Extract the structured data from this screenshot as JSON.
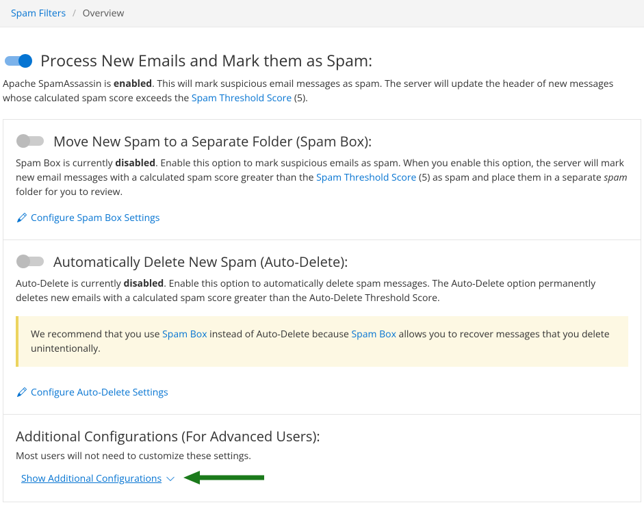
{
  "breadcrumb": {
    "root_label": "Spam Filters",
    "current_label": "Overview"
  },
  "section1": {
    "title": "Process New Emails and Mark them as Spam:",
    "desc_pre": "Apache SpamAssassin is ",
    "status": "enabled",
    "desc_post_a": ". This will mark suspicious email messages as spam. The server will update the header of new messages whose calculated spam score exceeds the ",
    "link_label": "Spam Threshold Score",
    "threshold_suffix": " (5)."
  },
  "section2": {
    "title": "Move New Spam to a Separate Folder (Spam Box):",
    "desc_pre": "Spam Box is currently ",
    "status": "disabled",
    "desc_mid_a": ". Enable this option to mark suspicious emails as spam. When you enable this option, the server will mark new email messages with a calculated spam score greater than the ",
    "link_label": "Spam Threshold Score",
    "desc_mid_b": " (5) as spam and place them in a separate ",
    "spam_ital": "spam",
    "desc_end": " folder for you to review.",
    "configure_label": "Configure Spam Box Settings"
  },
  "section3": {
    "title": "Automatically Delete New Spam (Auto-Delete):",
    "desc_pre": "Auto-Delete is currently ",
    "status": "disabled",
    "desc_post": ". Enable this option to automatically delete spam messages. The Auto-Delete option permanently deletes new emails with a calculated spam score greater than the Auto-Delete Threshold Score.",
    "callout_pre": "We recommend that you use ",
    "callout_link1": "Spam Box",
    "callout_mid": " instead of Auto-Delete because ",
    "callout_link2": "Spam Box",
    "callout_post": " allows you to recover messages that you delete unintentionally.",
    "configure_label": "Configure Auto-Delete Settings"
  },
  "advanced": {
    "title": "Additional Configurations (For Advanced Users):",
    "subtitle": "Most users will not need to customize these settings.",
    "show_label": "Show Additional Configurations"
  }
}
